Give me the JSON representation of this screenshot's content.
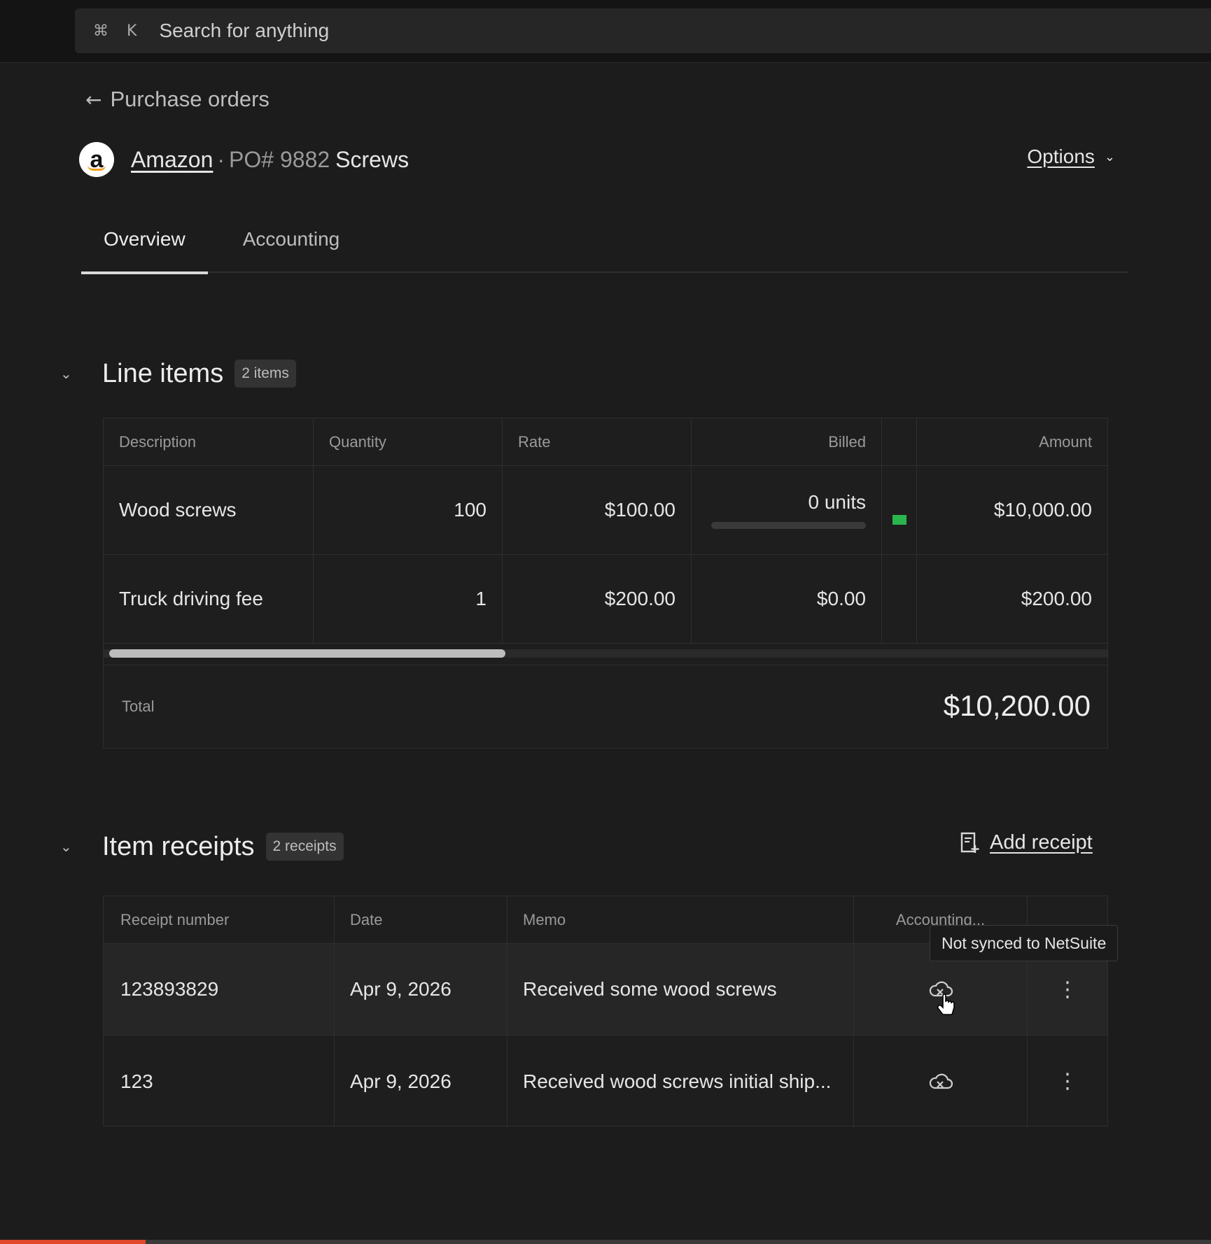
{
  "search": {
    "cmd_key": "⌘",
    "k_key": "K",
    "placeholder": "Search for anything"
  },
  "breadcrumb": {
    "back_label": "Purchase orders"
  },
  "header": {
    "vendor": "Amazon",
    "separator": "·",
    "po_number": "PO# 9882",
    "po_name": "Screws",
    "options_label": "Options"
  },
  "tabs": [
    {
      "label": "Overview",
      "active": true
    },
    {
      "label": "Accounting",
      "active": false
    }
  ],
  "line_items": {
    "title": "Line items",
    "badge": "2 items",
    "columns": [
      "Description",
      "Quantity",
      "Rate",
      "Billed",
      "Amount"
    ],
    "rows": [
      {
        "description": "Wood screws",
        "quantity": "100",
        "rate": "$100.00",
        "billed": "0 units",
        "billed_progress": 0,
        "amount": "$10,000.00"
      },
      {
        "description": "Truck driving fee",
        "quantity": "1",
        "rate": "$200.00",
        "billed": "$0.00",
        "amount": "$200.00"
      }
    ],
    "total_label": "Total",
    "total_value": "$10,200.00"
  },
  "item_receipts": {
    "title": "Item receipts",
    "badge": "2 receipts",
    "add_label": "Add receipt",
    "columns": [
      "Receipt number",
      "Date",
      "Memo",
      "Accounting..."
    ],
    "rows": [
      {
        "receipt_number": "123893829",
        "date": "Apr 9, 2026",
        "memo": "Received some wood screws"
      },
      {
        "receipt_number": "123",
        "date": "Apr 9, 2026",
        "memo": "Received wood screws initial ship..."
      }
    ],
    "tooltip": "Not synced to NetSuite"
  },
  "colors": {
    "accent_green": "#2bb54f",
    "video_progress": "#e14a2c"
  },
  "video_progress": 0.12
}
